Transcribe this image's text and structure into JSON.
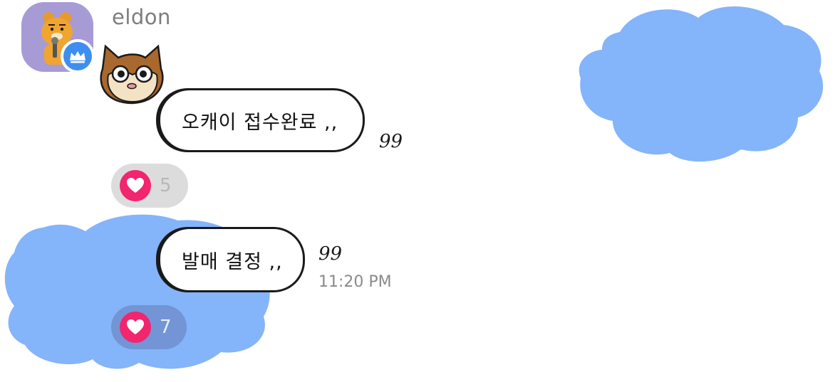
{
  "sender": {
    "name": "eldon",
    "avatar_icon": "lion-character-icon",
    "badge_icon": "crown-icon"
  },
  "sticker": {
    "icon": "cat-face-sticker"
  },
  "messages": [
    {
      "text": "오캐이 접수완료 ,,",
      "read_count": "99",
      "reaction": {
        "icon": "heart-icon",
        "count": "5"
      }
    },
    {
      "text": "발매 결정 ,,",
      "read_count": "99",
      "time": "11:20 PM",
      "reaction": {
        "icon": "heart-icon",
        "count": "7"
      }
    }
  ],
  "colors": {
    "scribble_blue": "#84b4fa",
    "heart_pink": "#f2256f",
    "badge_blue": "#3d8ef0",
    "avatar_purple": "#a79bd6"
  }
}
